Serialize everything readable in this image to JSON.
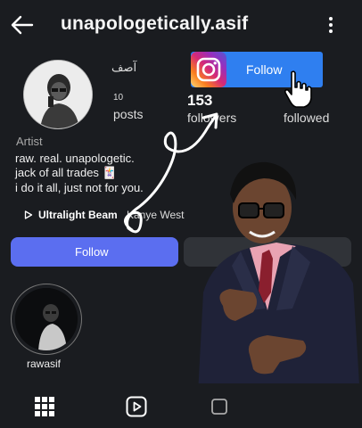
{
  "header": {
    "back_icon": "arrow-left-icon",
    "username": "unapologetically.asif",
    "menu_icon": "kebab-menu-icon"
  },
  "profile": {
    "display_name": "آصف",
    "posts_count": "10",
    "posts_label": "posts",
    "followers_count": "153",
    "followers_label": "followers",
    "following_label": "followed"
  },
  "overlay": {
    "ig_logo": "instagram-logo-icon",
    "follow_label": "Follow",
    "cursor": "hand-pointer-icon",
    "accent": "#2f7ff0"
  },
  "bio": {
    "category": "Artist",
    "lines": [
      "raw. real. unapologetic.",
      "jack of all trades 🃏",
      "i do it all, just not for you."
    ],
    "music_icon": "play-outline-icon",
    "music_title": "Ultralight Beam",
    "music_artist": "Kanye West"
  },
  "actions": {
    "follow_label": "Follow",
    "follow_color": "#5b6ef0"
  },
  "highlights": [
    {
      "label": "rawasif"
    }
  ],
  "tabs": {
    "grid": "grid-icon",
    "reels": "reels-icon",
    "tagged": "tagged-icon"
  }
}
